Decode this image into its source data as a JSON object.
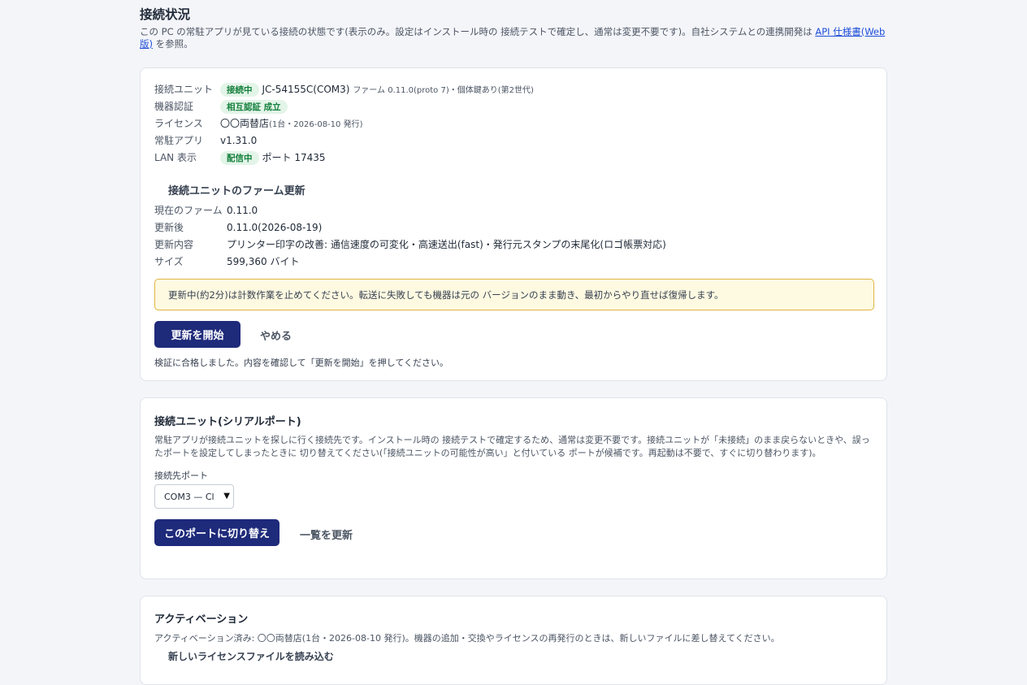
{
  "header": {
    "title": "接続状況",
    "desc_pre": "この PC の常駐アプリが見ている接続の状態です(表示のみ。設定はインストール時の 接続テストで確定し、通常は変更不要です)。自社システムとの連携開発は",
    "desc_link": "API 仕様書(Web 版)",
    "desc_post": "を参照。"
  },
  "status": {
    "unit_label": "接続ユニット",
    "unit_badge": "接続中",
    "unit_value": "JC-54155C(COM3)",
    "unit_detail": "ファーム 0.11.0(proto 7)・個体鍵あり(第2世代)",
    "auth_label": "機器認証",
    "auth_badge": "相互認証 成立",
    "license_label": "ライセンス",
    "license_value": "〇〇両替店",
    "license_detail": "(1台・2026-08-10 発行)",
    "app_label": "常駐アプリ",
    "app_value": "v1.31.0",
    "lan_label": "LAN 表示",
    "lan_badge": "配信中",
    "lan_value": "ポート 17435"
  },
  "firmware": {
    "title": "接続ユニットのファーム更新",
    "current_label": "現在のファーム",
    "current_value": "0.11.0",
    "after_label": "更新後",
    "after_value": "0.11.0(2026-08-19)",
    "content_label": "更新内容",
    "content_value": "プリンター印字の改善: 通信速度の可変化・高速送出(fast)・発行元スタンプの末尾化(ロゴ帳票対応)",
    "size_label": "サイズ",
    "size_value": "599,360 バイト",
    "warning": "更新中(約2分)は計数作業を止めてください。転送に失敗しても機器は元の バージョンのまま動き、最初からやり直せば復帰します。",
    "start_button": "更新を開始",
    "cancel_button": "やめる",
    "verify_note": "検証に合格しました。内容を確認して「更新を開始」を押してください。"
  },
  "serial": {
    "title": "接続ユニット(シリアルポート)",
    "desc": "常駐アプリが接続ユニットを探しに行く接続先です。インストール時の 接続テストで確定するため、通常は変更不要です。接続ユニットが「未接続」のまま戻らないときや、誤ったポートを設定してしまったときに 切り替えてください(「接続ユニットの可能性が高い」と付いている ポートが候補です。再起動は不要で、すぐに切り替わります)。",
    "port_label": "接続先ポート",
    "port_selected": "COM3 — Cl",
    "switch_button": "このポートに切り替え",
    "refresh_button": "一覧を更新"
  },
  "activation": {
    "title": "アクティベーション",
    "desc": "アクティベーション済み: 〇〇両替店(1台・2026-08-10 発行)。機器の追加・交換やライセンスの再発行のときは、新しいファイルに差し替えてください。",
    "load_label": "新しいライセンスファイルを読み込む"
  }
}
